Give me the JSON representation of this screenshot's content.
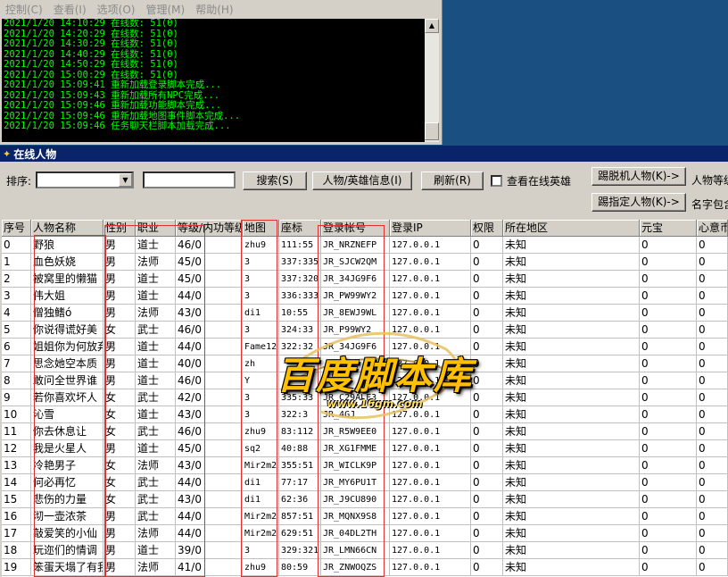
{
  "console": {
    "menu": [
      "控制(C)",
      "查看(I)",
      "选项(O)",
      "管理(M)",
      "帮助(H)"
    ],
    "log_lines": [
      "2021/1/20 14:10:29 在线数: 51(0)",
      "2021/1/20 14:20:29 在线数: 51(0)",
      "2021/1/20 14:30:29 在线数: 51(0)",
      "2021/1/20 14:40:29 在线数: 51(0)",
      "2021/1/20 14:50:29 在线数: 51(0)",
      "2021/1/20 15:00:29 在线数: 51(0)",
      "2021/1/20 15:09:41 重新加载登录脚本完成...",
      "2021/1/20 15:09:43 重新加载所有NPC完成...",
      "2021/1/20 15:09:46 重新加载功能脚本完成...",
      "2021/1/20 15:09:46 重新加载地图事件脚本完成...",
      "2021/1/20 15:09:46 任务聊天栏脚本加载完成..."
    ]
  },
  "online_window": {
    "title": "在线人物",
    "sort_label": "排序:",
    "search_button": "搜索(S)",
    "hero_info_button": "人物/英雄信息(I)",
    "refresh_button": "刷新(R)",
    "online_hero_label": "查看在线英雄",
    "kick_offline_button": "踢脱机人物(K)->",
    "kick_selected_button": "踢指定人物(K)->",
    "level_label": "人物等级",
    "name_contains_label": "名字包含"
  },
  "table": {
    "columns": [
      "序号",
      "人物名称",
      "性别",
      "职业",
      "等级/内功等级",
      "地图",
      "座标",
      "登录帐号",
      "登录IP",
      "权限",
      "所在地区",
      "元宝",
      "心意币"
    ],
    "rows": [
      [
        "0",
        "野狼",
        "男",
        "道士",
        "46/0",
        "zhu9",
        "111:55",
        "JR_NRZNEFP",
        "127.0.0.1",
        "0",
        "未知",
        "0",
        "0"
      ],
      [
        "1",
        "血色妖娆",
        "男",
        "法师",
        "45/0",
        "3",
        "337:335",
        "JR_SJCW2QM",
        "127.0.0.1",
        "0",
        "未知",
        "0",
        "0"
      ],
      [
        "2",
        "被窝里的懒猫",
        "男",
        "道士",
        "45/0",
        "3",
        "337:320",
        "JR_34JG9F6",
        "127.0.0.1",
        "0",
        "未知",
        "0",
        "0"
      ],
      [
        "3",
        "伟大姐",
        "男",
        "道士",
        "44/0",
        "3",
        "336:333",
        "JR_PW99WY2",
        "127.0.0.1",
        "0",
        "未知",
        "0",
        "0"
      ],
      [
        "4",
        "僧独鳍ó",
        "男",
        "法师",
        "43/0",
        "di1",
        "10:55",
        "JR_8EWJ9WL",
        "127.0.0.1",
        "0",
        "未知",
        "0",
        "0"
      ],
      [
        "5",
        "你说得谎好美",
        "女",
        "武士",
        "46/0",
        "3",
        "324:33",
        "JR_P99WY2",
        "127.0.0.1",
        "0",
        "未知",
        "0",
        "0"
      ],
      [
        "6",
        "姐姐你为何放弃",
        "男",
        "道士",
        "44/0",
        "Fame12",
        "322:32",
        "JR_34JG9F6",
        "127.0.0.1",
        "0",
        "未知",
        "0",
        "0"
      ],
      [
        "7",
        "思念她空本质",
        "男",
        "道士",
        "40/0",
        "zh",
        "",
        "",
        "127.0.0.1",
        "0",
        "未知",
        "0",
        "0"
      ],
      [
        "8",
        "敢问全世界谁",
        "男",
        "道士",
        "46/0",
        "Y",
        "",
        "",
        "127.0.0.1",
        "0",
        "未知",
        "0",
        "0"
      ],
      [
        "9",
        "若你喜欢坏人",
        "女",
        "武士",
        "42/0",
        "3",
        "335:33",
        "JR_C29ALF3",
        "127.0.0.1",
        "0",
        "未知",
        "0",
        "0"
      ],
      [
        "10",
        "沁雪",
        "女",
        "道士",
        "43/0",
        "3",
        "322:3",
        "JR_4GJ",
        "127.0.0.1",
        "0",
        "未知",
        "0",
        "0"
      ],
      [
        "11",
        "你去休息让",
        "女",
        "武士",
        "46/0",
        "zhu9",
        "83:112",
        "JR_R5W9EE0",
        "127.0.0.1",
        "0",
        "未知",
        "0",
        "0"
      ],
      [
        "12",
        "我是火星人",
        "男",
        "道士",
        "45/0",
        "sq2",
        "40:88",
        "JR_XG1FMME",
        "127.0.0.1",
        "0",
        "未知",
        "0",
        "0"
      ],
      [
        "13",
        "冷艳男子",
        "女",
        "法师",
        "43/0",
        "Mir2m2",
        "355:51",
        "JR_WICLK9P",
        "127.0.0.1",
        "0",
        "未知",
        "0",
        "0"
      ],
      [
        "14",
        "何必再忆",
        "女",
        "武士",
        "44/0",
        "di1",
        "77:17",
        "JR_MY6PU1T",
        "127.0.0.1",
        "0",
        "未知",
        "0",
        "0"
      ],
      [
        "15",
        "悲伤的力量",
        "女",
        "武士",
        "43/0",
        "di1",
        "62:36",
        "JR_J9CU890",
        "127.0.0.1",
        "0",
        "未知",
        "0",
        "0"
      ],
      [
        "16",
        "沏一壶浓茶",
        "男",
        "武士",
        "44/0",
        "Mir2m2",
        "857:51",
        "JR_MQNX9S8",
        "127.0.0.1",
        "0",
        "未知",
        "0",
        "0"
      ],
      [
        "17",
        "敲爱笑的小仙",
        "男",
        "法师",
        "44/0",
        "Mir2m2",
        "629:51",
        "JR_04DL2TH",
        "127.0.0.1",
        "0",
        "未知",
        "0",
        "0"
      ],
      [
        "18",
        "玩迩们的情调",
        "男",
        "道士",
        "39/0",
        "3",
        "329:321",
        "JR_LMN66CN",
        "127.0.0.1",
        "0",
        "未知",
        "0",
        "0"
      ],
      [
        "19",
        "笨蛋天塌了有我",
        "男",
        "法师",
        "41/0",
        "zhu9",
        "80:59",
        "JR_ZNWOQZS",
        "127.0.0.1",
        "0",
        "未知",
        "0",
        "0"
      ]
    ]
  },
  "watermark": {
    "main": "百度脚本库",
    "url": "www.16gm.com"
  },
  "colors": {
    "log_text": "#00ff00",
    "title_bar": "#0a246a",
    "highlight_box": "#e03030",
    "watermark": "#ffc000",
    "desktop": "#1a4f82"
  }
}
